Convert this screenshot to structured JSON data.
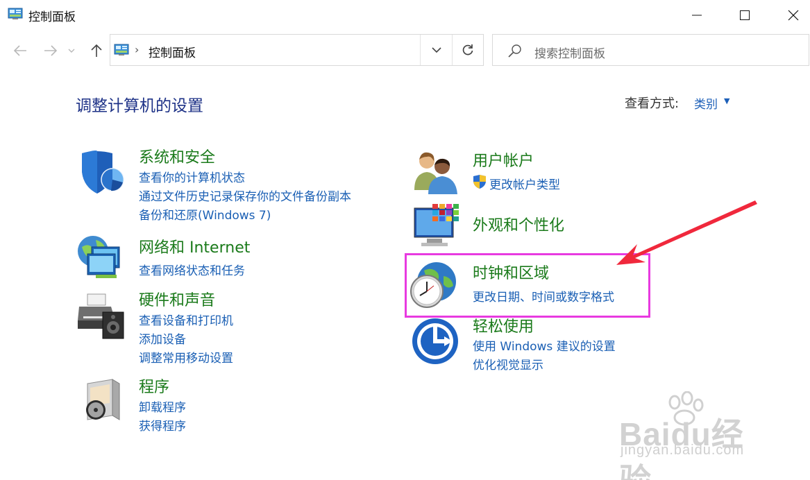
{
  "window": {
    "title": "控制面板"
  },
  "address_bar": {
    "breadcrumb": "控制面板"
  },
  "search": {
    "placeholder": "搜索控制面板"
  },
  "header": {
    "title": "调整计算机的设置",
    "view_by_label": "查看方式:",
    "view_by_value": "类别"
  },
  "categories": {
    "system_security": {
      "title": "系统和安全",
      "links": [
        "查看你的计算机状态",
        "通过文件历史记录保存你的文件备份副本",
        "备份和还原(Windows 7)"
      ]
    },
    "network": {
      "title": "网络和 Internet",
      "links": [
        "查看网络状态和任务"
      ]
    },
    "hardware": {
      "title": "硬件和声音",
      "links": [
        "查看设备和打印机",
        "添加设备",
        "调整常用移动设置"
      ]
    },
    "programs": {
      "title": "程序",
      "links": [
        "卸载程序",
        "获得程序"
      ]
    },
    "user_accounts": {
      "title": "用户帐户",
      "links": [
        "更改帐户类型"
      ]
    },
    "appearance": {
      "title": "外观和个性化",
      "links": []
    },
    "clock_region": {
      "title": "时钟和区域",
      "links": [
        "更改日期、时间或数字格式"
      ]
    },
    "ease_of_access": {
      "title": "轻松使用",
      "links": [
        "使用 Windows 建议的设置",
        "优化视觉显示"
      ]
    }
  },
  "watermark": {
    "brand": "Baidu经验",
    "url": "jingyan.baidu.com"
  },
  "colors": {
    "title_blue": "#1e3287",
    "category_green": "#1a7a1a",
    "link_blue": "#1a5fb4",
    "highlight_magenta": "#e83ae0",
    "arrow_red": "#f0283c"
  }
}
